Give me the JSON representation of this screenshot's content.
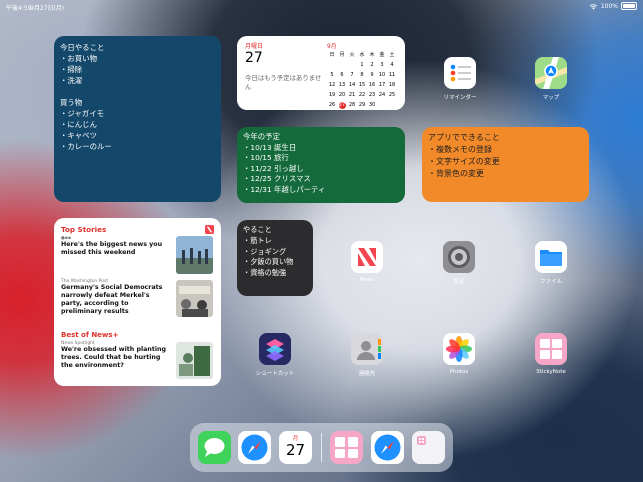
{
  "status_bar": {
    "time": "午後4:59",
    "date": "9月27日(月)",
    "battery": "100%"
  },
  "memo_widget": {
    "text": "今日やること\n・お買い物\n・掃除\n・洗濯\n\n買う物\n・ジャガイモ\n・にんじん\n・キャベツ\n・カレーのルー"
  },
  "calendar_widget": {
    "day_of_week": "月曜日",
    "day": "27",
    "no_events": "今日はもう予定はありません",
    "month_label": "9月",
    "weekdays": [
      "日",
      "月",
      "火",
      "水",
      "木",
      "金",
      "土"
    ],
    "days": [
      "",
      "",
      "",
      "1",
      "2",
      "3",
      "4",
      "5",
      "6",
      "7",
      "8",
      "9",
      "10",
      "11",
      "12",
      "13",
      "14",
      "15",
      "16",
      "17",
      "18",
      "19",
      "20",
      "21",
      "22",
      "23",
      "24",
      "25",
      "26",
      "27",
      "28",
      "29",
      "30",
      "",
      ""
    ],
    "today": "27"
  },
  "yotei_widget": {
    "text": "今年の予定\n・10/13 誕生日\n・10/15 旅行\n・11/22 引っ越し\n・12/25 クリスマス\n・12/31 年越しパーティ"
  },
  "apps_widget": {
    "text": "アプリでできること\n・複数メモの登録\n・文字サイズの変更\n・背景色の変更"
  },
  "news_widget": {
    "header": "Top Stories",
    "stories": [
      {
        "source": "",
        "title": "Here's the biggest news you missed this weekend"
      },
      {
        "source": "The Washington Post",
        "title": "Germany's Social Democrats narrowly defeat Merkel's party, according to preliminary results"
      }
    ],
    "section": "Best of News+",
    "featured": {
      "source": "News Spotlight",
      "title": "We're obsessed with planting trees. Could that be hurting the environment?"
    }
  },
  "todo_widget": {
    "text": "やること\n・筋トレ\n・ジョギング\n・夕飯の買い物\n・資格の勉強"
  },
  "apps": [
    {
      "label": "リマインダー",
      "icon": "reminders-icon"
    },
    {
      "label": "マップ",
      "icon": "maps-icon"
    },
    {
      "label": "News",
      "icon": "news-icon"
    },
    {
      "label": "設定",
      "icon": "settings-icon"
    },
    {
      "label": "ファイル",
      "icon": "files-icon"
    },
    {
      "label": "ショートカット",
      "icon": "shortcuts-icon"
    },
    {
      "label": "連絡先",
      "icon": "contacts-icon"
    },
    {
      "label": "Photos",
      "icon": "photos-icon"
    },
    {
      "label": "StickyNote",
      "icon": "stickynote-icon"
    }
  ],
  "dock": {
    "items": [
      "messages-icon",
      "safari-icon",
      "calendar-icon",
      "stickynote-icon",
      "safari-icon",
      "recent-apps-icon"
    ],
    "calendar_dow": "月",
    "calendar_day": "27"
  },
  "colors": {
    "memo_bg": "#14486a",
    "yotei_bg": "#146a3a",
    "apps_bg": "#f28a2a",
    "todo_bg": "#2c2c2e",
    "accent_red": "#e0302c"
  }
}
